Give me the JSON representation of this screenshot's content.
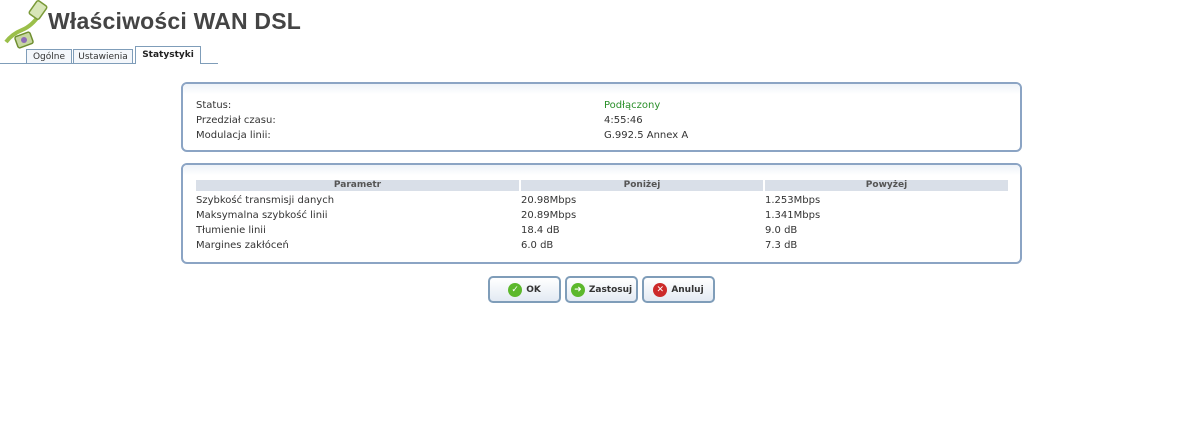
{
  "page": {
    "title": "Właściwości WAN DSL"
  },
  "tabs": [
    {
      "label": "Ogólne",
      "active": false
    },
    {
      "label": "Ustawienia",
      "active": false
    },
    {
      "label": "Statystyki",
      "active": true
    }
  ],
  "status_box": {
    "rows": [
      {
        "label": "Status:",
        "value": "Podłączony"
      },
      {
        "label": "Przedział czasu:",
        "value": "4:55:46"
      },
      {
        "label": "Modulacja linii:",
        "value": "G.992.5 Annex A"
      }
    ]
  },
  "stats_table": {
    "headers": [
      "Parametr",
      "Poniżej",
      "Powyżej"
    ],
    "rows": [
      [
        "Szybkość transmisji danych",
        "20.98Mbps",
        "1.253Mbps"
      ],
      [
        "Maksymalna szybkość linii",
        "20.89Mbps",
        "1.341Mbps"
      ],
      [
        "Tłumienie linii",
        "18.4 dB",
        "9.0 dB"
      ],
      [
        "Margines zakłóceń",
        "6.0 dB",
        "7.3 dB"
      ]
    ]
  },
  "buttons": {
    "ok": "OK",
    "apply": "Zastosuj",
    "cancel": "Anuluj"
  },
  "colors": {
    "connected": "#2a8f2a",
    "border": "#8ba4c4"
  }
}
